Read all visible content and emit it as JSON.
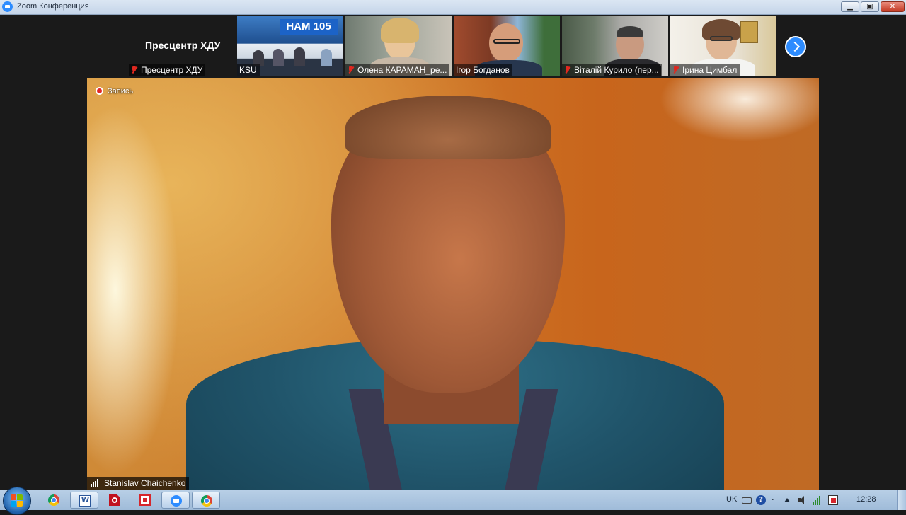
{
  "window": {
    "title": "Zoom Конференция",
    "controls": {
      "minimize": "▁",
      "maximize": "▣",
      "close": "✕"
    }
  },
  "gallery": {
    "presenter_label": "Пресцентр ХДУ",
    "tiles": [
      {
        "name": "Пресцентр ХДУ",
        "muted": true
      },
      {
        "name": "KSU",
        "muted": false,
        "banner": "НАМ 105"
      },
      {
        "name": "Олена КАРАМАН_ре...",
        "muted": true
      },
      {
        "name": "Ігор Богданов",
        "muted": false
      },
      {
        "name": "Віталій Курило (пер...",
        "muted": true
      },
      {
        "name": "Ірина Цимбал",
        "muted": true
      }
    ],
    "next_icon": "chevron-right-icon"
  },
  "main_video": {
    "recording_label": "Запись",
    "speaker_name": "Stanislav Chaichenko"
  },
  "taskbar": {
    "apps": [
      {
        "name": "chrome",
        "icon": "chrome-icon",
        "active": false
      },
      {
        "name": "word",
        "icon": "word-icon",
        "active": true
      },
      {
        "name": "acrobat",
        "icon": "pdf-icon",
        "active": false
      },
      {
        "name": "presentation",
        "icon": "red-app-icon",
        "active": false
      },
      {
        "name": "zoom",
        "icon": "zoom-icon",
        "active": true
      },
      {
        "name": "chrome",
        "icon": "chrome-icon",
        "active": true
      }
    ],
    "tray": {
      "language": "UK",
      "clock": "12:28"
    }
  },
  "colors": {
    "zoom_blue": "#2d8cff",
    "record_red": "#e02828",
    "mute_red": "#e0281f"
  }
}
